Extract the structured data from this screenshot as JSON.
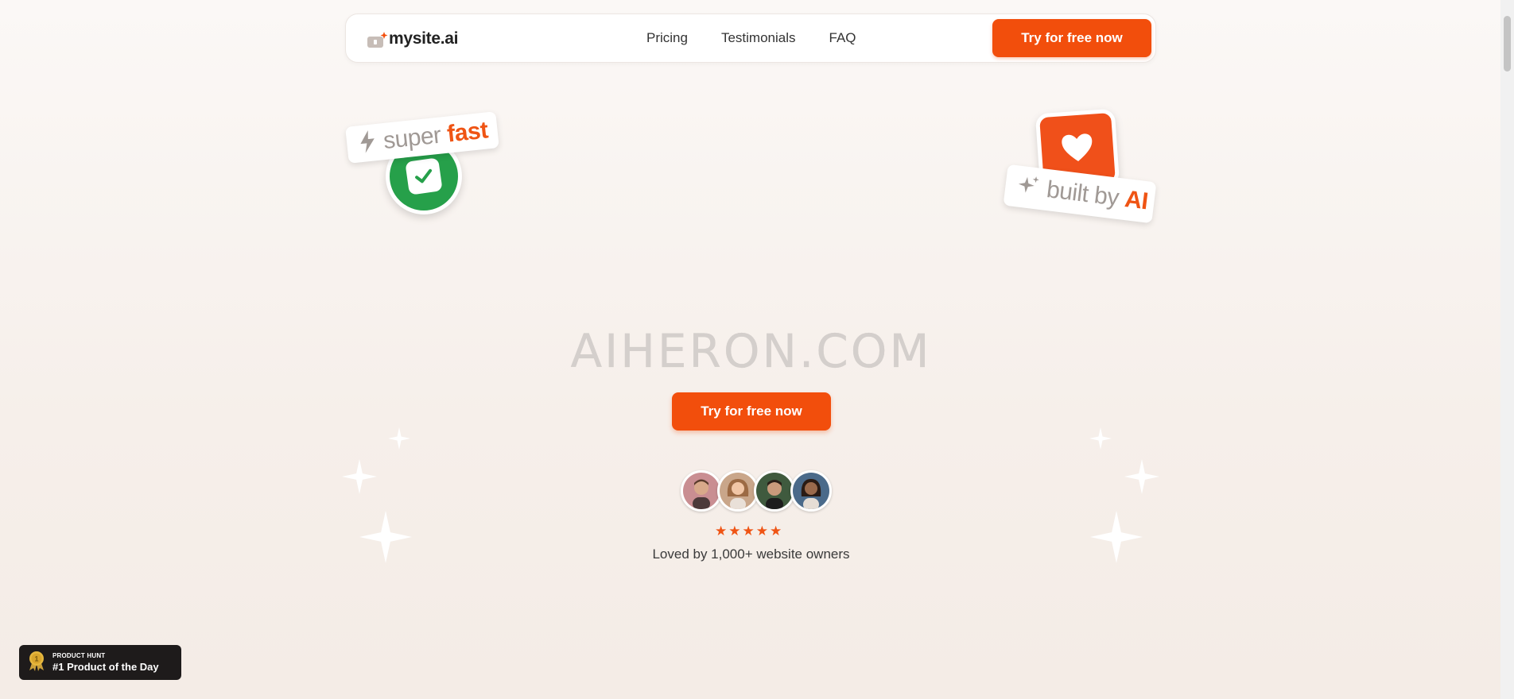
{
  "navbar": {
    "logo_text": "mysite.ai",
    "links": [
      {
        "label": "Pricing"
      },
      {
        "label": "Testimonials"
      },
      {
        "label": "FAQ"
      }
    ],
    "cta_label": "Try for free now"
  },
  "stickers": {
    "fast_word1": "super",
    "fast_word2": "fast",
    "ai_word1": "built by",
    "ai_word2": "AI"
  },
  "hero": {
    "heading": "AIHERON.COM",
    "cta_label": "Try for free now",
    "rating_stars": 5,
    "loved_text": "Loved by 1,000+ website owners"
  },
  "product_hunt": {
    "small_label": "PRODUCT HUNT",
    "title": "#1 Product of the Day"
  },
  "colors": {
    "accent": "#f24e0c",
    "green": "#26a04a",
    "dark_badge": "#1e1b1b"
  }
}
